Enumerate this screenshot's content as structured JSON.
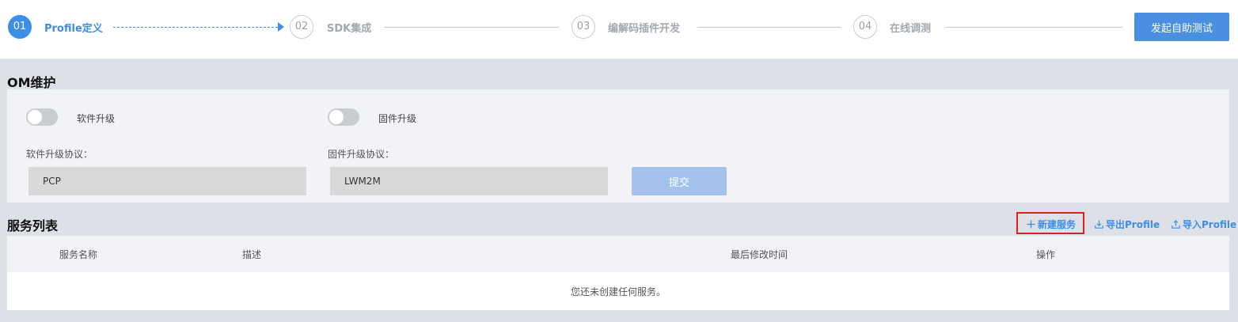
{
  "stepper": {
    "steps": [
      {
        "number": "01",
        "label": "Profile定义"
      },
      {
        "number": "02",
        "label": "SDK集成"
      },
      {
        "number": "03",
        "label": "编解码插件开发"
      },
      {
        "number": "04",
        "label": "在线调测"
      }
    ],
    "active_step": "01",
    "launch_button": "发起自助测试"
  },
  "om": {
    "title": "OM维护",
    "software_toggle_label": "软件升级",
    "firmware_toggle_label": "固件升级",
    "software_protocol_label": "软件升级协议：",
    "software_protocol_value": "PCP",
    "firmware_protocol_label": "固件升级协议：",
    "firmware_protocol_value": "LWM2M",
    "submit_label": "提交"
  },
  "services": {
    "title": "服务列表",
    "actions": {
      "new_service": "新建服务",
      "export_profile": "导出Profile",
      "import_profile": "导入Profile"
    },
    "columns": [
      "服务名称",
      "描述",
      "最后修改时间",
      "操作"
    ],
    "empty_message": "您还未创建任何服务。"
  },
  "colors": {
    "accent": "#3d8ee6",
    "highlight": "#e02020",
    "panel_bg": "#f1f3f6",
    "page_bg": "#dde1e7"
  }
}
